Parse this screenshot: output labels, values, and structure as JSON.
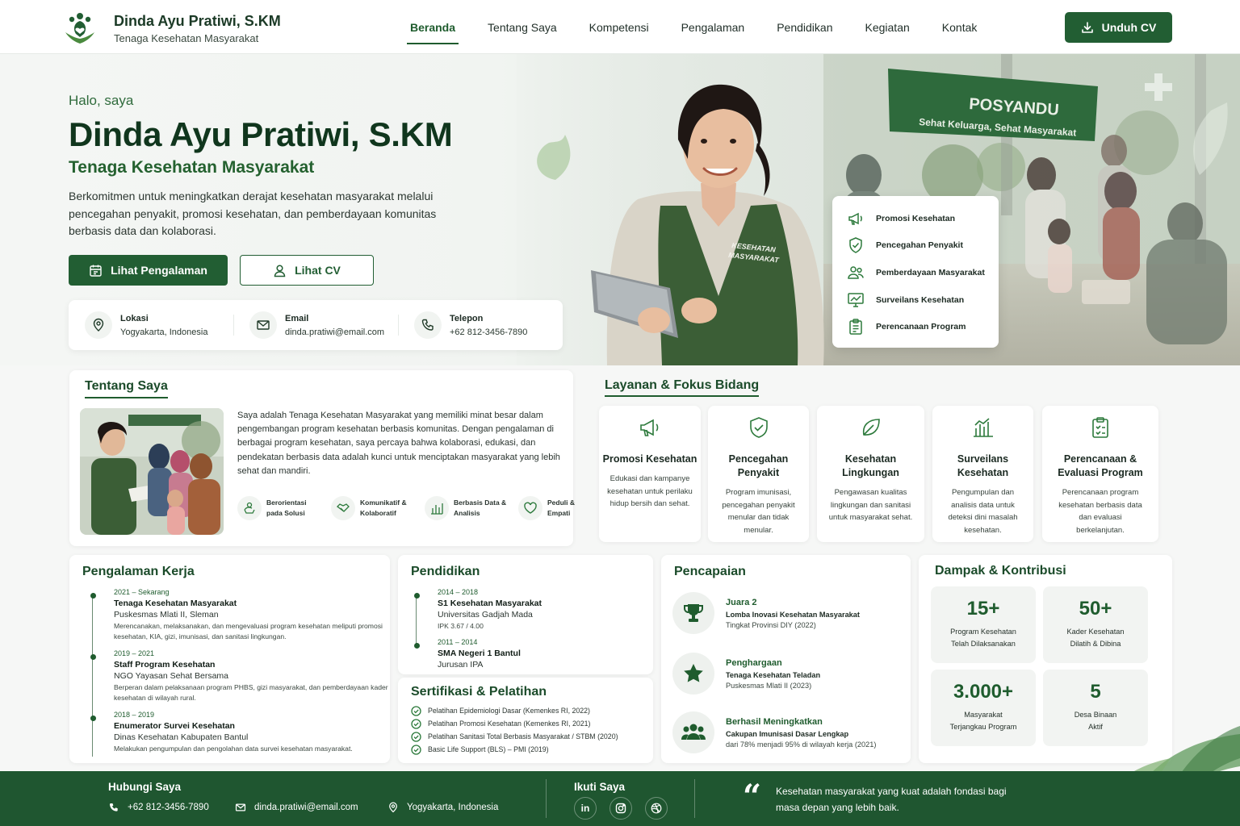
{
  "header": {
    "name": "Dinda Ayu Pratiwi, S.KM",
    "subtitle": "Tenaga Kesehatan Masyarakat",
    "nav": [
      "Beranda",
      "Tentang Saya",
      "Kompetensi",
      "Pengalaman",
      "Pendidikan",
      "Kegiatan",
      "Kontak"
    ],
    "active_nav": "Beranda",
    "download_cv": "Unduh CV"
  },
  "hero": {
    "greeting": "Halo, saya",
    "name": "Dinda Ayu Pratiwi, S.KM",
    "role": "Tenaga Kesehatan Masyarakat",
    "description": "Berkomitmen untuk meningkatkan derajat kesehatan masyarakat melalui pencegahan penyakit, promosi kesehatan, dan pemberdayaan komunitas berbasis data dan kolaborasi.",
    "btn_experience": "Lihat Pengalaman",
    "btn_cv": "Lihat CV",
    "contact": [
      {
        "label": "Lokasi",
        "value": "Yogyakarta, Indonesia",
        "icon": "location-pin-icon"
      },
      {
        "label": "Email",
        "value": "dinda.pratiwi@email.com",
        "icon": "mail-icon"
      },
      {
        "label": "Telepon",
        "value": "+62 812-3456-7890",
        "icon": "phone-icon"
      }
    ],
    "vest_text": [
      "KESEHATAN",
      "MASYARAKAT"
    ],
    "banner": {
      "title": "POSYANDU",
      "subtitle": "Sehat Keluarga, Sehat Masyarakat"
    },
    "focus_list": [
      "Promosi Kesehatan",
      "Pencegahan Penyakit",
      "Pemberdayaan Masyarakat",
      "Surveilans Kesehatan",
      "Perencanaan Program"
    ]
  },
  "about": {
    "title": "Tentang Saya",
    "text": "Saya adalah Tenaga Kesehatan Masyarakat yang memiliki minat besar dalam pengembangan program kesehatan berbasis komunitas. Dengan pengalaman di berbagai program kesehatan, saya percaya bahwa kolaborasi, edukasi, dan pendekatan berbasis data adalah kunci untuk menciptakan masyarakat yang lebih sehat dan mandiri.",
    "traits": [
      {
        "l1": "Berorientasi",
        "l2": "pada Solusi",
        "icon": "solution-icon"
      },
      {
        "l1": "Komunikatif &",
        "l2": "Kolaboratif",
        "icon": "handshake-icon"
      },
      {
        "l1": "Berbasis Data &",
        "l2": "Analisis",
        "icon": "bar-chart-icon"
      },
      {
        "l1": "Peduli &",
        "l2": "Empati",
        "icon": "heart-icon"
      }
    ]
  },
  "services": {
    "title": "Layanan & Fokus Bidang",
    "items": [
      {
        "title": "Promosi Kesehatan",
        "desc": "Edukasi dan kampanye kesehatan untuk perilaku hidup bersih dan sehat."
      },
      {
        "title": "Pencegahan Penyakit",
        "desc": "Program imunisasi, pencegahan penyakit menular dan tidak menular."
      },
      {
        "title": "Kesehatan Lingkungan",
        "desc": "Pengawasan kualitas lingkungan dan sanitasi untuk masyarakat sehat."
      },
      {
        "title": "Surveilans Kesehatan",
        "desc": "Pengumpulan dan analisis data untuk deteksi dini masalah kesehatan."
      },
      {
        "title": "Perencanaan & Evaluasi Program",
        "desc": "Perencanaan program kesehatan berbasis data dan evaluasi berkelanjutan."
      }
    ]
  },
  "experience": {
    "title": "Pengalaman Kerja",
    "items": [
      {
        "year": "2021 – Sekarang",
        "role": "Tenaga Kesehatan Masyarakat",
        "org": "Puskesmas Mlati II, Sleman",
        "desc": "Merencanakan, melaksanakan, dan mengevaluasi program kesehatan meliputi promosi kesehatan, KIA, gizi, imunisasi, dan sanitasi lingkungan."
      },
      {
        "year": "2019 – 2021",
        "role": "Staff Program Kesehatan",
        "org": "NGO Yayasan Sehat Bersama",
        "desc": "Berperan dalam pelaksanaan program PHBS, gizi masyarakat, dan pemberdayaan kader kesehatan di wilayah rural."
      },
      {
        "year": "2018 – 2019",
        "role": "Enumerator Survei Kesehatan",
        "org": "Dinas Kesehatan Kabupaten Bantul",
        "desc": "Melakukan pengumpulan dan pengolahan data survei kesehatan masyarakat."
      }
    ]
  },
  "education": {
    "title": "Pendidikan",
    "items": [
      {
        "year": "2014 – 2018",
        "degree": "S1 Kesehatan Masyarakat",
        "school": "Universitas Gadjah Mada",
        "note": "IPK 3.67 / 4.00"
      },
      {
        "year": "2011 – 2014",
        "degree": "SMA Negeri 1 Bantul",
        "school": "Jurusan IPA",
        "note": ""
      }
    ]
  },
  "certifications": {
    "title": "Sertifikasi & Pelatihan",
    "items": [
      "Pelatihan Epidemiologi Dasar (Kemenkes RI, 2022)",
      "Pelatihan Promosi Kesehatan (Kemenkes RI, 2021)",
      "Pelatihan Sanitasi Total Berbasis Masyarakat / STBM (2020)",
      "Basic Life Support (BLS) – PMI (2019)"
    ]
  },
  "achievements": {
    "title": "Pencapaian",
    "items": [
      {
        "title": "Juara 2",
        "sub": "Lomba Inovasi Kesehatan Masyarakat",
        "note": "Tingkat Provinsi DIY (2022)",
        "icon": "trophy-icon"
      },
      {
        "title": "Penghargaan",
        "sub": "Tenaga Kesehatan Teladan",
        "note": "Puskesmas Mlati II (2023)",
        "icon": "star-icon"
      },
      {
        "title": "Berhasil Meningkatkan",
        "sub": "Cakupan Imunisasi Dasar Lengkap",
        "note": "dari 78% menjadi 95% di wilayah kerja (2021)",
        "icon": "community-icon"
      }
    ]
  },
  "impact": {
    "title": "Dampak & Kontribusi",
    "stats": [
      {
        "value": "15+",
        "l1": "Program Kesehatan",
        "l2": "Telah Dilaksanakan"
      },
      {
        "value": "50+",
        "l1": "Kader Kesehatan",
        "l2": "Dilatih & Dibina"
      },
      {
        "value": "3.000+",
        "l1": "Masyarakat",
        "l2": "Terjangkau Program"
      },
      {
        "value": "5",
        "l1": "Desa Binaan",
        "l2": "Aktif"
      }
    ]
  },
  "footer": {
    "contact_title": "Hubungi Saya",
    "phone": "+62 812-3456-7890",
    "email": "dinda.pratiwi@email.com",
    "location": "Yogyakarta, Indonesia",
    "follow_title": "Ikuti Saya",
    "quote": "Kesehatan masyarakat yang kuat adalah fondasi bagi masa depan yang lebih baik."
  },
  "colors": {
    "primary": "#225e33",
    "primary_dark": "#10361d",
    "accent": "#2f6b3c",
    "background": "#f6f7f6"
  }
}
